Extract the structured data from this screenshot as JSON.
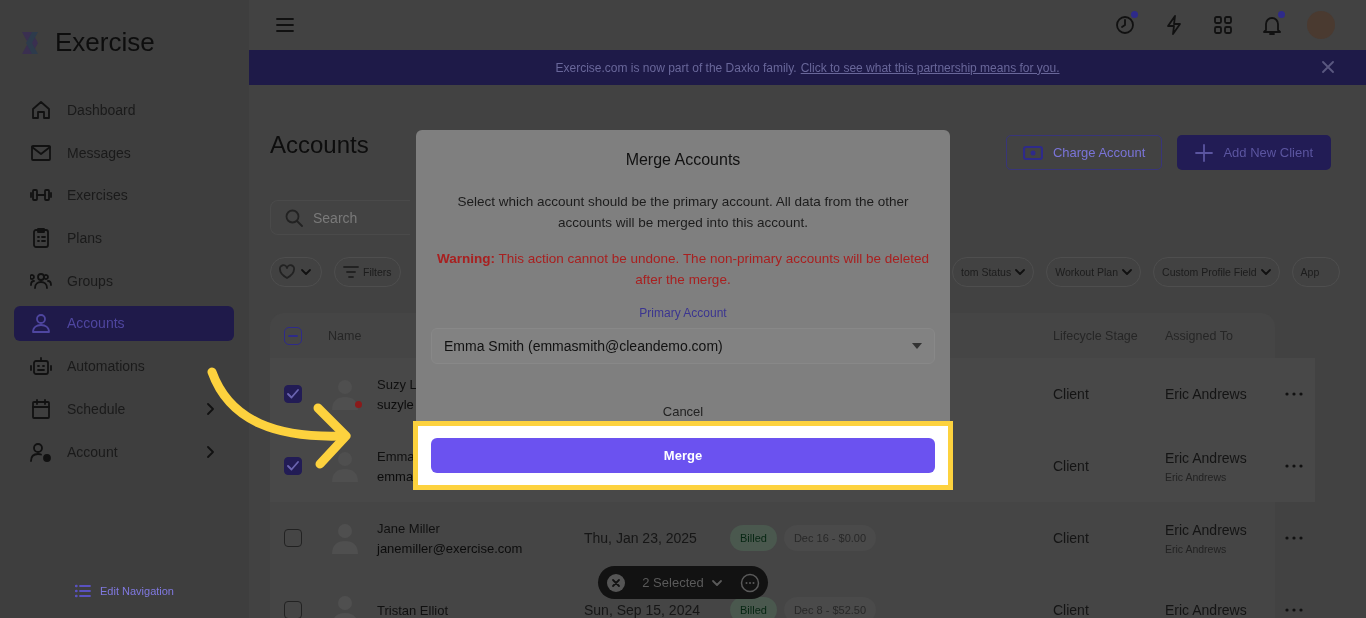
{
  "sidebar": {
    "logo": "Exercise",
    "items": [
      {
        "label": "Dashboard",
        "selected": false,
        "expandable": false
      },
      {
        "label": "Messages",
        "selected": false,
        "expandable": false
      },
      {
        "label": "Exercises",
        "selected": false,
        "expandable": false
      },
      {
        "label": "Plans",
        "selected": false,
        "expandable": false
      },
      {
        "label": "Groups",
        "selected": false,
        "expandable": false
      },
      {
        "label": "Accounts",
        "selected": true,
        "expandable": false
      },
      {
        "label": "Automations",
        "selected": false,
        "expandable": false
      },
      {
        "label": "Schedule",
        "selected": false,
        "expandable": true
      },
      {
        "label": "Account",
        "selected": false,
        "expandable": true
      }
    ],
    "edit_navigation": "Edit Navigation"
  },
  "header": {
    "icons": [
      {
        "badge": true
      },
      {
        "badge": false
      },
      {
        "badge": false
      },
      {
        "badge": true
      }
    ]
  },
  "banner": {
    "text": "Exercise.com is now part of the Daxko family.",
    "link": "Click to see what this partnership means for you."
  },
  "page": {
    "title": "Accounts",
    "buttons": [
      {
        "label": "Charge Account",
        "kind": "outline"
      },
      {
        "label": "Add New Client",
        "kind": "primary"
      }
    ],
    "search": {
      "placeholder": "Search"
    },
    "filters": [
      {
        "kind": "favorite"
      },
      {
        "kind": "filter",
        "label": "Filters"
      },
      {
        "kind": "dropdown",
        "label": "tom Status"
      },
      {
        "kind": "dropdown",
        "label": "Workout Plan"
      },
      {
        "kind": "dropdown",
        "label": "Custom Profile Field"
      },
      {
        "kind": "cut",
        "label": "App"
      }
    ]
  },
  "table": {
    "select_all": {
      "mixed": true
    },
    "columns": [
      "Name",
      "Lifecycle Stage",
      "Assigned To"
    ],
    "rows": [
      {
        "selected": true,
        "alert": true,
        "name": "Suzy L",
        "email": "suzyle",
        "lifecycle": "Client",
        "assigned": "Eric Andrews"
      },
      {
        "selected": true,
        "alert": false,
        "name": "Emma",
        "email": "emma",
        "lifecycle": "Client",
        "assigned": "Eric Andrews",
        "assigned_sub": "Eric Andrews"
      },
      {
        "selected": false,
        "alert": false,
        "name": "Jane Miller",
        "email": "janemiller@exercise.com",
        "date": "Thu, Jan 23, 2025",
        "tags": [
          {
            "kind": "status",
            "label": "Billed"
          },
          {
            "kind": "invoice",
            "label": "Dec 16 - $0.00"
          }
        ],
        "lifecycle": "Client",
        "assigned": "Eric Andrews",
        "assigned_sub": "Eric Andrews"
      },
      {
        "selected": false,
        "alert": false,
        "name": "Tristan Elliot",
        "date": "Sun, Sep 15, 2024",
        "tags": [
          {
            "kind": "status",
            "label": "Billed"
          },
          {
            "kind": "invoice",
            "label": "Dec 8 - $52.50"
          }
        ],
        "lifecycle": "Client",
        "assigned": "Eric Andrews"
      }
    ]
  },
  "selection_bar": {
    "label": "2 Selected"
  },
  "modal": {
    "title": "Merge Accounts",
    "description": "Select which account should be the primary account. All data from the other accounts will be merged into this account.",
    "warning": "**Warning:** This action cannot be undone. The non-primary accounts will be deleted after the merge.",
    "field_label": "Primary Account",
    "value": "Emma Smith (emmasmith@cleandemo.com)",
    "cancel": "Cancel",
    "confirm": "Merge"
  }
}
